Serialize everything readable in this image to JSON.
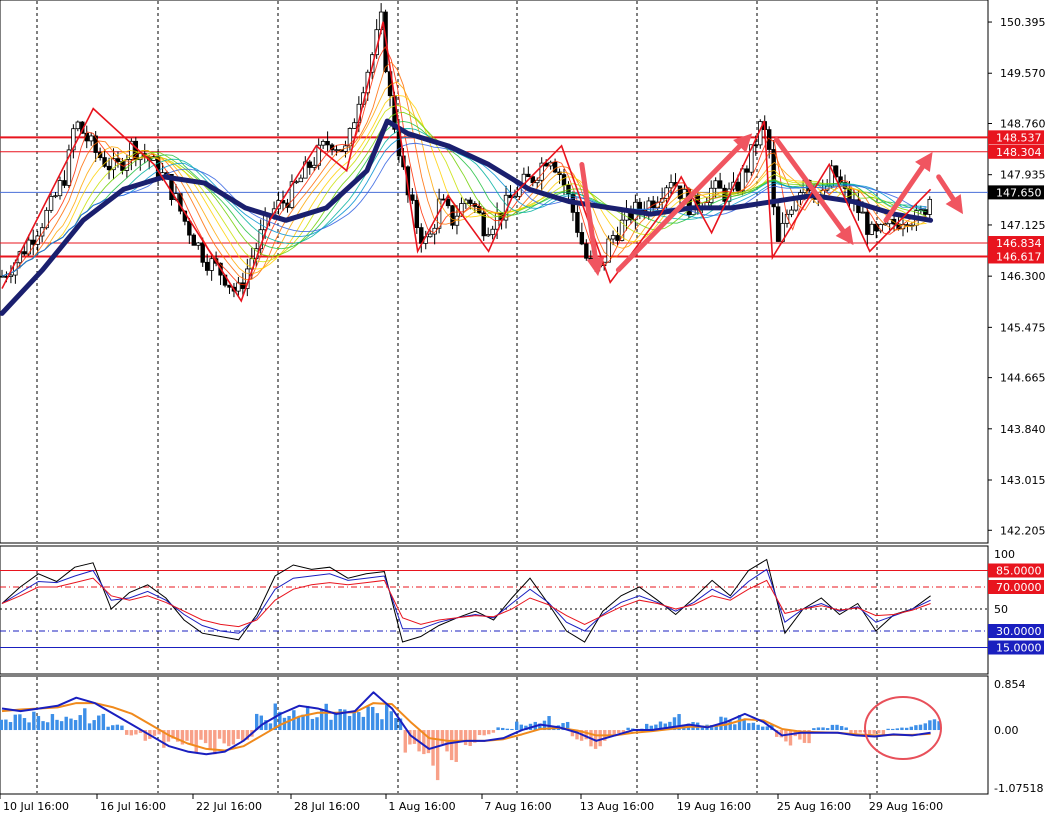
{
  "chart_data": {
    "type": "candlestick",
    "main_panel": {
      "price_axis_labels": [
        "150.395",
        "149.570",
        "148.760",
        "147.935",
        "147.125",
        "146.300",
        "145.475",
        "144.665",
        "143.840",
        "143.015",
        "142.205"
      ],
      "ylim": [
        142.0,
        150.75
      ],
      "current_price": {
        "value": 147.65,
        "label": "147.650"
      },
      "horizontal_levels": [
        {
          "value": 148.537,
          "label": "148.537"
        },
        {
          "value": 148.304,
          "label": "148.304"
        },
        {
          "value": 146.834,
          "label": "146.834"
        },
        {
          "value": 146.617,
          "label": "146.617"
        }
      ],
      "close_path": [
        [
          0,
          146.3
        ],
        [
          0.8,
          146.6
        ],
        [
          1.6,
          147.0
        ],
        [
          2.4,
          147.4
        ],
        [
          3.2,
          148.0
        ],
        [
          3.6,
          148.8
        ],
        [
          4.6,
          148.3
        ],
        [
          5.6,
          148.0
        ],
        [
          6.4,
          148.4
        ],
        [
          7.2,
          148.2
        ],
        [
          8.2,
          147.8
        ],
        [
          9.0,
          147.2
        ],
        [
          10.0,
          146.6
        ],
        [
          11.0,
          146.3
        ],
        [
          11.6,
          146.0
        ],
        [
          12.2,
          146.5
        ],
        [
          13.2,
          147.3
        ],
        [
          14.2,
          147.6
        ],
        [
          15.2,
          148.1
        ],
        [
          16.2,
          148.5
        ],
        [
          17.0,
          148.3
        ],
        [
          17.6,
          149.2
        ],
        [
          18.2,
          149.8
        ],
        [
          18.7,
          150.4
        ],
        [
          19.1,
          149.2
        ],
        [
          19.5,
          148.5
        ],
        [
          20.0,
          147.6
        ],
        [
          20.6,
          147.0
        ],
        [
          21.0,
          146.8
        ],
        [
          21.6,
          147.5
        ],
        [
          22.2,
          147.2
        ],
        [
          23.0,
          147.6
        ],
        [
          23.8,
          147.1
        ],
        [
          24.6,
          147.3
        ],
        [
          25.4,
          147.7
        ],
        [
          26.2,
          147.9
        ],
        [
          27.0,
          148.3
        ],
        [
          27.6,
          147.9
        ],
        [
          28.2,
          147.3
        ],
        [
          28.8,
          146.6
        ],
        [
          29.4,
          146.3
        ],
        [
          30.0,
          146.9
        ],
        [
          31.0,
          147.3
        ],
        [
          32.0,
          147.5
        ],
        [
          33.0,
          147.9
        ],
        [
          34.0,
          147.4
        ],
        [
          35.0,
          147.7
        ],
        [
          36.0,
          147.6
        ],
        [
          36.8,
          148.1
        ],
        [
          37.4,
          148.7
        ],
        [
          37.8,
          148.5
        ],
        [
          38.2,
          146.7
        ],
        [
          38.8,
          147.4
        ],
        [
          39.6,
          147.9
        ],
        [
          40.4,
          147.5
        ],
        [
          41.0,
          148.0
        ],
        [
          41.6,
          147.6
        ],
        [
          42.4,
          147.3
        ],
        [
          43.0,
          146.9
        ],
        [
          43.8,
          147.1
        ],
        [
          44.6,
          147.3
        ],
        [
          45.2,
          147.2
        ],
        [
          45.8,
          147.6
        ]
      ],
      "moving_averages": [
        {
          "color": "#1a1f6e",
          "width": 5,
          "points": [
            [
              0,
              145.7
            ],
            [
              2,
              146.4
            ],
            [
              4,
              147.2
            ],
            [
              6,
              147.7
            ],
            [
              8,
              147.9
            ],
            [
              10,
              147.8
            ],
            [
              12,
              147.4
            ],
            [
              14,
              147.2
            ],
            [
              16,
              147.4
            ],
            [
              18,
              148.0
            ],
            [
              19,
              148.8
            ],
            [
              20,
              148.6
            ],
            [
              22,
              148.4
            ],
            [
              24,
              148.1
            ],
            [
              26,
              147.7
            ],
            [
              28,
              147.5
            ],
            [
              30,
              147.4
            ],
            [
              32,
              147.3
            ],
            [
              34,
              147.4
            ],
            [
              36,
              147.4
            ],
            [
              38,
              147.5
            ],
            [
              40,
              147.6
            ],
            [
              42,
              147.5
            ],
            [
              44,
              147.3
            ],
            [
              45.8,
              147.2
            ]
          ]
        }
      ],
      "zigzag": [
        [
          0,
          146.1
        ],
        [
          4.5,
          149.0
        ],
        [
          7.5,
          148.1
        ],
        [
          11.8,
          145.9
        ],
        [
          13.2,
          147.2
        ],
        [
          15.5,
          148.4
        ],
        [
          17.0,
          148.0
        ],
        [
          18.8,
          150.4
        ],
        [
          20.5,
          146.7
        ],
        [
          22.0,
          147.6
        ],
        [
          24.0,
          146.7
        ],
        [
          25.2,
          147.6
        ],
        [
          27.6,
          148.4
        ],
        [
          30.0,
          146.2
        ],
        [
          32.5,
          147.3
        ],
        [
          33.5,
          147.9
        ],
        [
          35.0,
          147.0
        ],
        [
          37.6,
          148.8
        ],
        [
          38.0,
          146.6
        ],
        [
          40.8,
          148.1
        ],
        [
          42.8,
          146.7
        ],
        [
          45.8,
          147.7
        ]
      ],
      "arrows": [
        [
          [
            28.6,
            148.1
          ],
          [
            29.4,
            146.3
          ]
        ],
        [
          [
            30.4,
            146.4
          ],
          [
            37.0,
            148.6
          ]
        ],
        [
          [
            38.2,
            148.5
          ],
          [
            42.0,
            146.8
          ]
        ],
        [
          [
            43.6,
            147.2
          ],
          [
            45.9,
            148.3
          ]
        ],
        [
          [
            46.2,
            147.9
          ],
          [
            47.4,
            147.3
          ]
        ]
      ],
      "date_labels": [
        "10 Jul 16:00",
        "16 Jul 16:00",
        "22 Jul 16:00",
        "28 Jul 16:00",
        "1 Aug 16:00",
        "7 Aug 16:00",
        "13 Aug 16:00",
        "19 Aug 16:00",
        "25 Aug 16:00",
        "29 Aug 16:00"
      ]
    },
    "stochastic_panel": {
      "axis_labels": [
        "100",
        "50"
      ],
      "levels": [
        {
          "value": 85,
          "label": "85.0000",
          "color": "#e8141e",
          "style": "solid"
        },
        {
          "value": 70,
          "label": "70.0000",
          "color": "#e8141e",
          "style": "dashdot"
        },
        {
          "value": 30,
          "label": "30.0000",
          "color": "#1a1fbf",
          "style": "dashdot"
        },
        {
          "value": 15,
          "label": "15.0000",
          "color": "#1a1fbf",
          "style": "solid"
        }
      ],
      "ylim": [
        0,
        100
      ],
      "lines": [
        {
          "color": "#000000",
          "values": [
            55,
            70,
            82,
            75,
            88,
            92,
            50,
            65,
            72,
            60,
            40,
            28,
            25,
            22,
            45,
            80,
            90,
            86,
            88,
            78,
            82,
            84,
            20,
            25,
            35,
            42,
            48,
            40,
            60,
            78,
            55,
            30,
            20,
            48,
            62,
            70,
            58,
            45,
            60,
            76,
            62,
            85,
            95,
            28,
            50,
            60,
            45,
            55,
            30,
            45,
            50,
            62
          ]
        },
        {
          "color": "#1a1fbf",
          "values": [
            55,
            65,
            75,
            74,
            80,
            85,
            58,
            60,
            66,
            58,
            45,
            35,
            30,
            28,
            42,
            68,
            78,
            80,
            82,
            76,
            78,
            80,
            32,
            32,
            38,
            42,
            45,
            42,
            55,
            68,
            56,
            38,
            30,
            45,
            56,
            62,
            56,
            48,
            56,
            68,
            60,
            75,
            86,
            38,
            50,
            55,
            48,
            52,
            38,
            44,
            50,
            58
          ]
        },
        {
          "color": "#e8141e",
          "values": [
            55,
            62,
            70,
            70,
            74,
            78,
            62,
            58,
            62,
            56,
            48,
            40,
            36,
            34,
            40,
            58,
            68,
            72,
            74,
            72,
            74,
            76,
            42,
            36,
            40,
            42,
            44,
            43,
            50,
            60,
            54,
            44,
            36,
            44,
            52,
            58,
            55,
            50,
            54,
            62,
            58,
            68,
            76,
            46,
            50,
            53,
            49,
            51,
            44,
            45,
            49,
            55
          ]
        }
      ]
    },
    "macd_panel": {
      "axis_labels": [
        "0.854",
        "0.00",
        "-1.07518"
      ],
      "ylim": [
        -1.07518,
        0.854
      ],
      "histogram": [
        0.2,
        0.3,
        0.35,
        0.4,
        0.45,
        0.3,
        0.1,
        -0.1,
        -0.2,
        -0.4,
        -0.5,
        -0.45,
        -0.3,
        -0.2,
        0.3,
        0.55,
        0.6,
        0.5,
        0.4,
        0.35,
        0.45,
        0.5,
        -0.6,
        -1.0,
        -0.6,
        -0.3,
        -0.1,
        0.05,
        0.2,
        0.3,
        0.15,
        -0.2,
        -0.35,
        -0.1,
        0.05,
        0.2,
        0.3,
        0.15,
        0.1,
        0.25,
        0.3,
        0.15,
        -0.3,
        -0.25,
        0.05,
        0.1,
        -0.1,
        -0.15,
        0.05,
        0.1,
        0.2
      ],
      "macd_line": [
        0.4,
        0.35,
        0.4,
        0.45,
        0.6,
        0.5,
        0.3,
        0.1,
        -0.1,
        -0.3,
        -0.4,
        -0.45,
        -0.4,
        -0.2,
        0.1,
        0.3,
        0.45,
        0.4,
        0.3,
        0.35,
        0.7,
        0.4,
        -0.1,
        -0.35,
        -0.25,
        -0.2,
        -0.2,
        -0.15,
        0.0,
        0.1,
        0.05,
        -0.05,
        -0.2,
        -0.1,
        0.0,
        0.0,
        0.05,
        0.1,
        0.05,
        0.15,
        0.3,
        0.15,
        -0.1,
        -0.05,
        -0.05,
        -0.05,
        -0.1,
        -0.12,
        -0.08,
        -0.1,
        -0.05
      ],
      "signal_line": [
        0.35,
        0.38,
        0.4,
        0.42,
        0.5,
        0.5,
        0.42,
        0.3,
        0.1,
        -0.1,
        -0.25,
        -0.35,
        -0.38,
        -0.3,
        -0.1,
        0.1,
        0.25,
        0.32,
        0.32,
        0.33,
        0.5,
        0.48,
        0.15,
        -0.15,
        -0.2,
        -0.2,
        -0.2,
        -0.17,
        -0.08,
        0.02,
        0.04,
        -0.01,
        -0.1,
        -0.1,
        -0.05,
        -0.02,
        0.02,
        0.06,
        0.06,
        0.1,
        0.2,
        0.18,
        0.02,
        -0.03,
        -0.04,
        -0.05,
        -0.08,
        -0.1,
        -0.09,
        -0.09,
        -0.07
      ]
    }
  }
}
